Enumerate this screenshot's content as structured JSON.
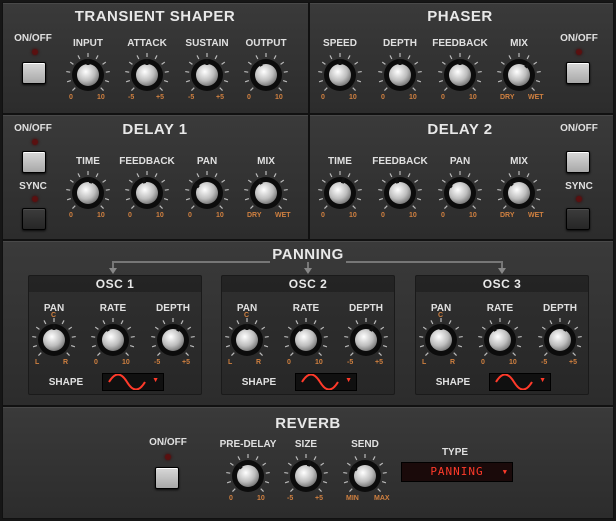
{
  "colors": {
    "panel": "#333333",
    "label": "#e0e0e0",
    "tick": "#d08040",
    "led_off": "#5a1010",
    "display_text": "#ff3a2a"
  },
  "transient": {
    "title": "TRANSIENT SHAPER",
    "onoff": "ON/OFF",
    "knobs": [
      {
        "label": "INPUT",
        "min": "0",
        "max": "10",
        "value": 0.5
      },
      {
        "label": "ATTACK",
        "min": "-5",
        "max": "+5",
        "value": 0.5
      },
      {
        "label": "SUSTAIN",
        "min": "-5",
        "max": "+5",
        "value": 0.5
      },
      {
        "label": "OUTPUT",
        "min": "0",
        "max": "10",
        "value": 0.4
      }
    ]
  },
  "phaser": {
    "title": "PHASER",
    "onoff": "ON/OFF",
    "knobs": [
      {
        "label": "SPEED",
        "min": "0",
        "max": "10",
        "value": 0.5
      },
      {
        "label": "DEPTH",
        "min": "0",
        "max": "10",
        "value": 0.5
      },
      {
        "label": "FEEDBACK",
        "min": "0",
        "max": "10",
        "value": 0.5
      },
      {
        "label": "MIX",
        "min": "DRY",
        "max": "WET",
        "value": 0.65
      }
    ]
  },
  "delay1": {
    "title": "DELAY 1",
    "onoff": "ON/OFF",
    "sync": "SYNC",
    "knobs": [
      {
        "label": "TIME",
        "min": "0",
        "max": "10",
        "value": 0.55
      },
      {
        "label": "FEEDBACK",
        "min": "0",
        "max": "10",
        "value": 0.45
      },
      {
        "label": "PAN",
        "min": "0",
        "max": "10",
        "value": 0.3
      },
      {
        "label": "MIX",
        "min": "DRY",
        "max": "WET",
        "value": 0.4
      }
    ]
  },
  "delay2": {
    "title": "DELAY 2",
    "onoff": "ON/OFF",
    "sync": "SYNC",
    "knobs": [
      {
        "label": "TIME",
        "min": "0",
        "max": "10",
        "value": 0.55
      },
      {
        "label": "FEEDBACK",
        "min": "0",
        "max": "10",
        "value": 0.45
      },
      {
        "label": "PAN",
        "min": "0",
        "max": "10",
        "value": 0.3
      },
      {
        "label": "MIX",
        "min": "DRY",
        "max": "WET",
        "value": 0.35
      }
    ]
  },
  "panning": {
    "title": "PANNING",
    "shape_label": "SHAPE",
    "oscs": [
      {
        "title": "OSC 1",
        "knobs": [
          {
            "label": "PAN",
            "center": "C",
            "min": "L",
            "max": "R",
            "value": 0.5
          },
          {
            "label": "RATE",
            "min": "0",
            "max": "10",
            "value": 0.4
          },
          {
            "label": "DEPTH",
            "min": "-5",
            "max": "+5",
            "value": 0.6
          }
        ]
      },
      {
        "title": "OSC 2",
        "knobs": [
          {
            "label": "PAN",
            "center": "C",
            "min": "L",
            "max": "R",
            "value": 0.5
          },
          {
            "label": "RATE",
            "min": "0",
            "max": "10",
            "value": 0.4
          },
          {
            "label": "DEPTH",
            "min": "-5",
            "max": "+5",
            "value": 0.6
          }
        ]
      },
      {
        "title": "OSC 3",
        "knobs": [
          {
            "label": "PAN",
            "center": "C",
            "min": "L",
            "max": "R",
            "value": 0.5
          },
          {
            "label": "RATE",
            "min": "0",
            "max": "10",
            "value": 0.4
          },
          {
            "label": "DEPTH",
            "min": "-5",
            "max": "+5",
            "value": 0.6
          }
        ]
      }
    ]
  },
  "reverb": {
    "title": "REVERB",
    "onoff": "ON/OFF",
    "type_label": "TYPE",
    "type_value": "PANNING",
    "knobs": [
      {
        "label": "PRE-DELAY",
        "min": "0",
        "max": "10",
        "value": 0.35
      },
      {
        "label": "SIZE",
        "min": "-5",
        "max": "+5",
        "value": 0.55
      },
      {
        "label": "SEND",
        "min": "MIN",
        "max": "MAX",
        "value": 0.3
      }
    ]
  }
}
